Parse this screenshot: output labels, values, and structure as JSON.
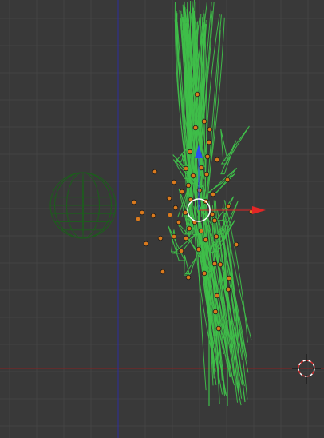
{
  "viewport": {
    "view": "Front Ortho",
    "background_color": "#393939",
    "grid_color": "#444444",
    "x_axis_color": "#8b1e1e",
    "z_axis_color": "#2d2d9b",
    "selected_object_color": "#3fbf4a",
    "unselected_object_color": "#1f5a1f",
    "particle_color": "#d97a1e",
    "gizmo": {
      "x_axis_color": "#e32626",
      "z_axis_color": "#2b4df2",
      "center_color": "#ffffff"
    },
    "cursor_icon": "3d-cursor-icon"
  }
}
